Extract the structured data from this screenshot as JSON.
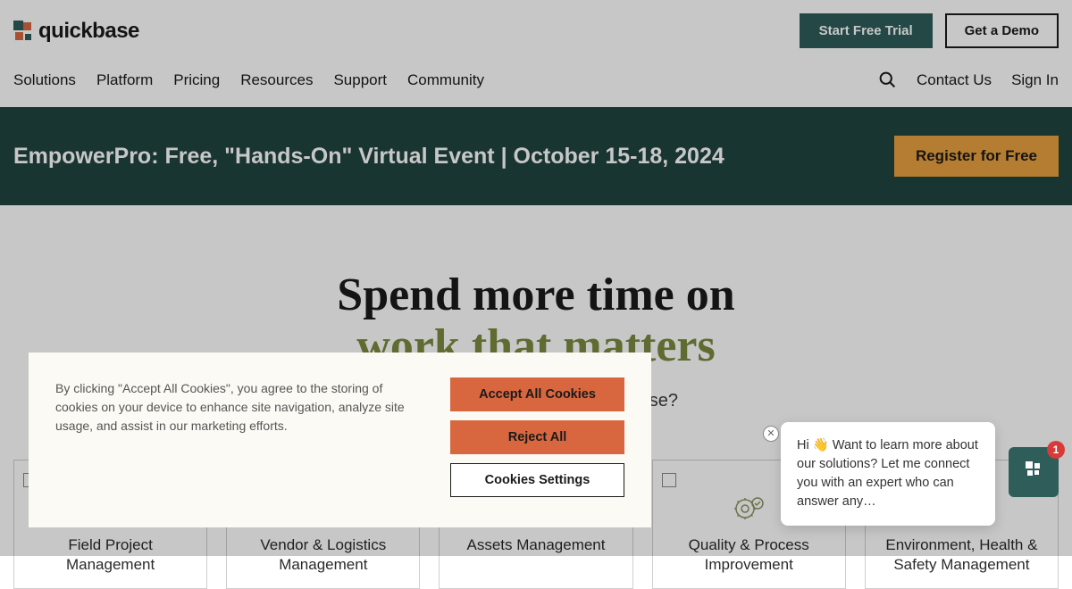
{
  "header": {
    "brand_text": "quickbase",
    "start_trial": "Start Free Trial",
    "get_demo": "Get a Demo"
  },
  "nav": {
    "items": [
      "Solutions",
      "Platform",
      "Pricing",
      "Resources",
      "Support",
      "Community"
    ],
    "contact": "Contact Us",
    "signin": "Sign In"
  },
  "banner": {
    "text": "EmpowerPro: Free, \"Hands-On\" Virtual Event | October 15-18, 2024",
    "cta": "Register for Free"
  },
  "hero": {
    "line1": "Spend more time on",
    "line2": "work that matters",
    "subtitle": "What will you build with Quickbase?"
  },
  "cards": [
    {
      "title": "Field Project Management"
    },
    {
      "title": "Vendor & Logistics Management"
    },
    {
      "title": "Assets Management"
    },
    {
      "title": "Quality & Process Improvement"
    },
    {
      "title": "Environment, Health & Safety Management"
    }
  ],
  "cookie": {
    "text": "By clicking \"Accept All Cookies\", you agree to the storing of cookies on your device to enhance site navigation, analyze site usage, and assist in our marketing efforts.",
    "accept": "Accept All Cookies",
    "reject": "Reject All",
    "settings": "Cookies Settings"
  },
  "chat": {
    "message": "Hi 👋 Want to learn more about our solutions? Let me connect you with an expert who can answer any…",
    "badge": "1"
  }
}
